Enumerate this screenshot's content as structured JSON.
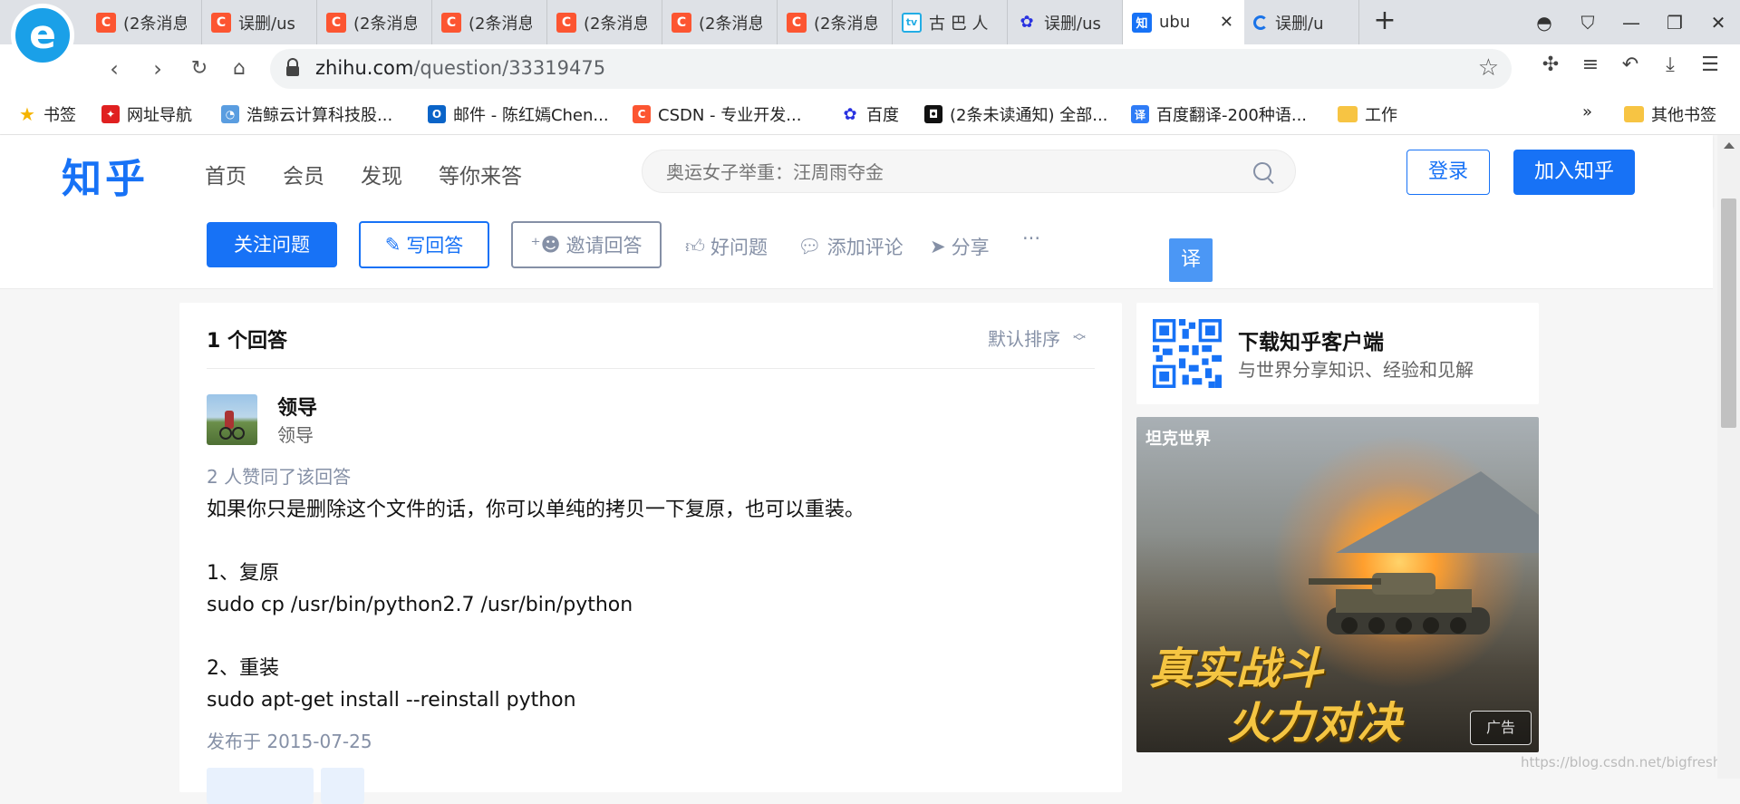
{
  "browser": {
    "tabs": [
      {
        "label": "(2条消息",
        "icon": "csdn-icon"
      },
      {
        "label": "误删/us",
        "icon": "csdn-icon"
      },
      {
        "label": "(2条消息",
        "icon": "csdn-icon"
      },
      {
        "label": "(2条消息",
        "icon": "csdn-icon"
      },
      {
        "label": "(2条消息",
        "icon": "csdn-icon"
      },
      {
        "label": "(2条消息",
        "icon": "csdn-icon"
      },
      {
        "label": "(2条消息",
        "icon": "csdn-icon"
      },
      {
        "label": "古 巴 人",
        "icon": "bilibili-icon"
      },
      {
        "label": "误删/us",
        "icon": "baidu-icon"
      },
      {
        "label": "ubu",
        "icon": "zhihu-icon",
        "active": true
      },
      {
        "label": "误删/u",
        "icon": "loading-icon"
      }
    ],
    "url_host": "zhihu.com",
    "url_path": "/question/33319475",
    "bookmarks": [
      {
        "label": "书签"
      },
      {
        "label": "网址导航"
      },
      {
        "label": "浩鲸云计算科技股..."
      },
      {
        "label": "邮件 - 陈红嫣Chen..."
      },
      {
        "label": "CSDN - 专业开发..."
      },
      {
        "label": "百度"
      },
      {
        "label": "(2条未读通知) 全部..."
      },
      {
        "label": "百度翻译-200种语..."
      },
      {
        "label": "工作"
      },
      {
        "label": "»"
      },
      {
        "label": "其他书签"
      }
    ]
  },
  "zhihu": {
    "logo": "知乎",
    "nav": [
      "首页",
      "会员",
      "发现",
      "等你来答"
    ],
    "search_placeholder": "奥运女子举重：汪周雨夺金",
    "login": "登录",
    "join": "加入知乎"
  },
  "question_bar": {
    "follow": "关注问题",
    "write": "写回答",
    "invite": "邀请回答",
    "good_question": "好问题",
    "add_comment": "添加评论",
    "share": "分享",
    "more": "···",
    "translate": "译"
  },
  "answers": {
    "count_label": "1 个回答",
    "sort_label": "默认排序",
    "author_name": "领导",
    "author_headline": "领导",
    "votes": "2 人赞同了该回答",
    "body": [
      [
        "如果你只是删除这个文件的话，你可以单纯的拷贝一下复原，也可以重装。"
      ],
      [
        "1、复原",
        "sudo cp /usr/bin/python2.7 /usr/bin/python"
      ],
      [
        "2、重装",
        "sudo apt-get install --reinstall python"
      ]
    ],
    "published": "发布于 2015-07-25"
  },
  "sidebar": {
    "app_title": "下载知乎客户端",
    "app_subtitle": "与世界分享知识、经验和见解",
    "ad_brand": "坦克世界",
    "ad_slogan_1": "真实战斗",
    "ad_slogan_2": "火力对决",
    "ad_tag": "广告"
  },
  "watermark": "https://blog.csdn.net/bigfresh_chy",
  "colors": {
    "zhihu_blue": "#1772f6",
    "csdn_red": "#fc5531"
  }
}
